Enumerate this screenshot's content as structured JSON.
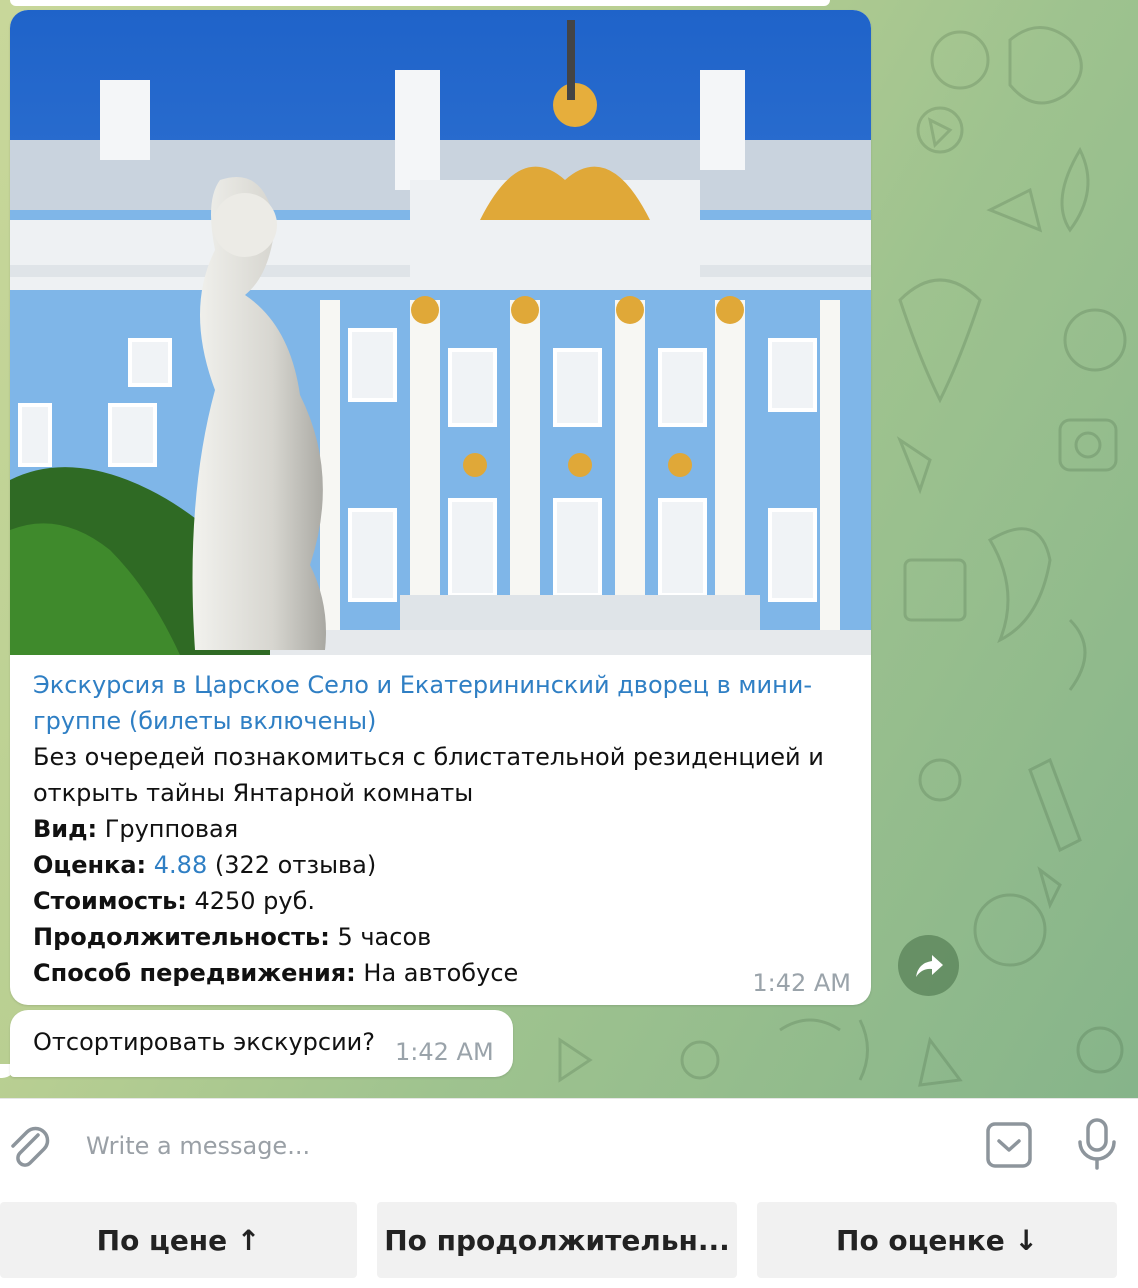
{
  "chat": {
    "post": {
      "title": "Экскурсия в Царское Село и Екатерининский дворец в мини-группе (билеты включены)",
      "description": "Без очередей познакомиться с блистательной резиденцией и открыть тайны Янтарной комнаты",
      "type_label": "Вид:",
      "type_value": " Групповая",
      "rating_label": "Оценка:",
      "rating_value": "4.88",
      "rating_reviews": " (322 отзыва)",
      "price_label": "Стоимость:",
      "price_value": "  4250 руб.",
      "duration_label": "Продолжительность:",
      "duration_value": "  5 часов",
      "transport_label": "Способ передвижения:",
      "transport_value": "  На автобусе",
      "time": "1:42 AM"
    },
    "prompt_message": {
      "text": "Отсортировать экскурсии?",
      "time": "1:42 AM"
    }
  },
  "composer": {
    "placeholder": "Write a message..."
  },
  "keyboard": {
    "buttons": [
      "По цене ↑",
      "По продолжительн...",
      "По оценке ↓"
    ]
  },
  "icons": {
    "forward": "forward-arrow-icon",
    "attach": "paperclip-icon",
    "keyboard": "bot-keyboard-icon",
    "mic": "microphone-icon"
  },
  "colors": {
    "link": "#2f7fc4",
    "chat_bg": "#b9cf92",
    "keyboard_button": "#f1f1f1"
  }
}
